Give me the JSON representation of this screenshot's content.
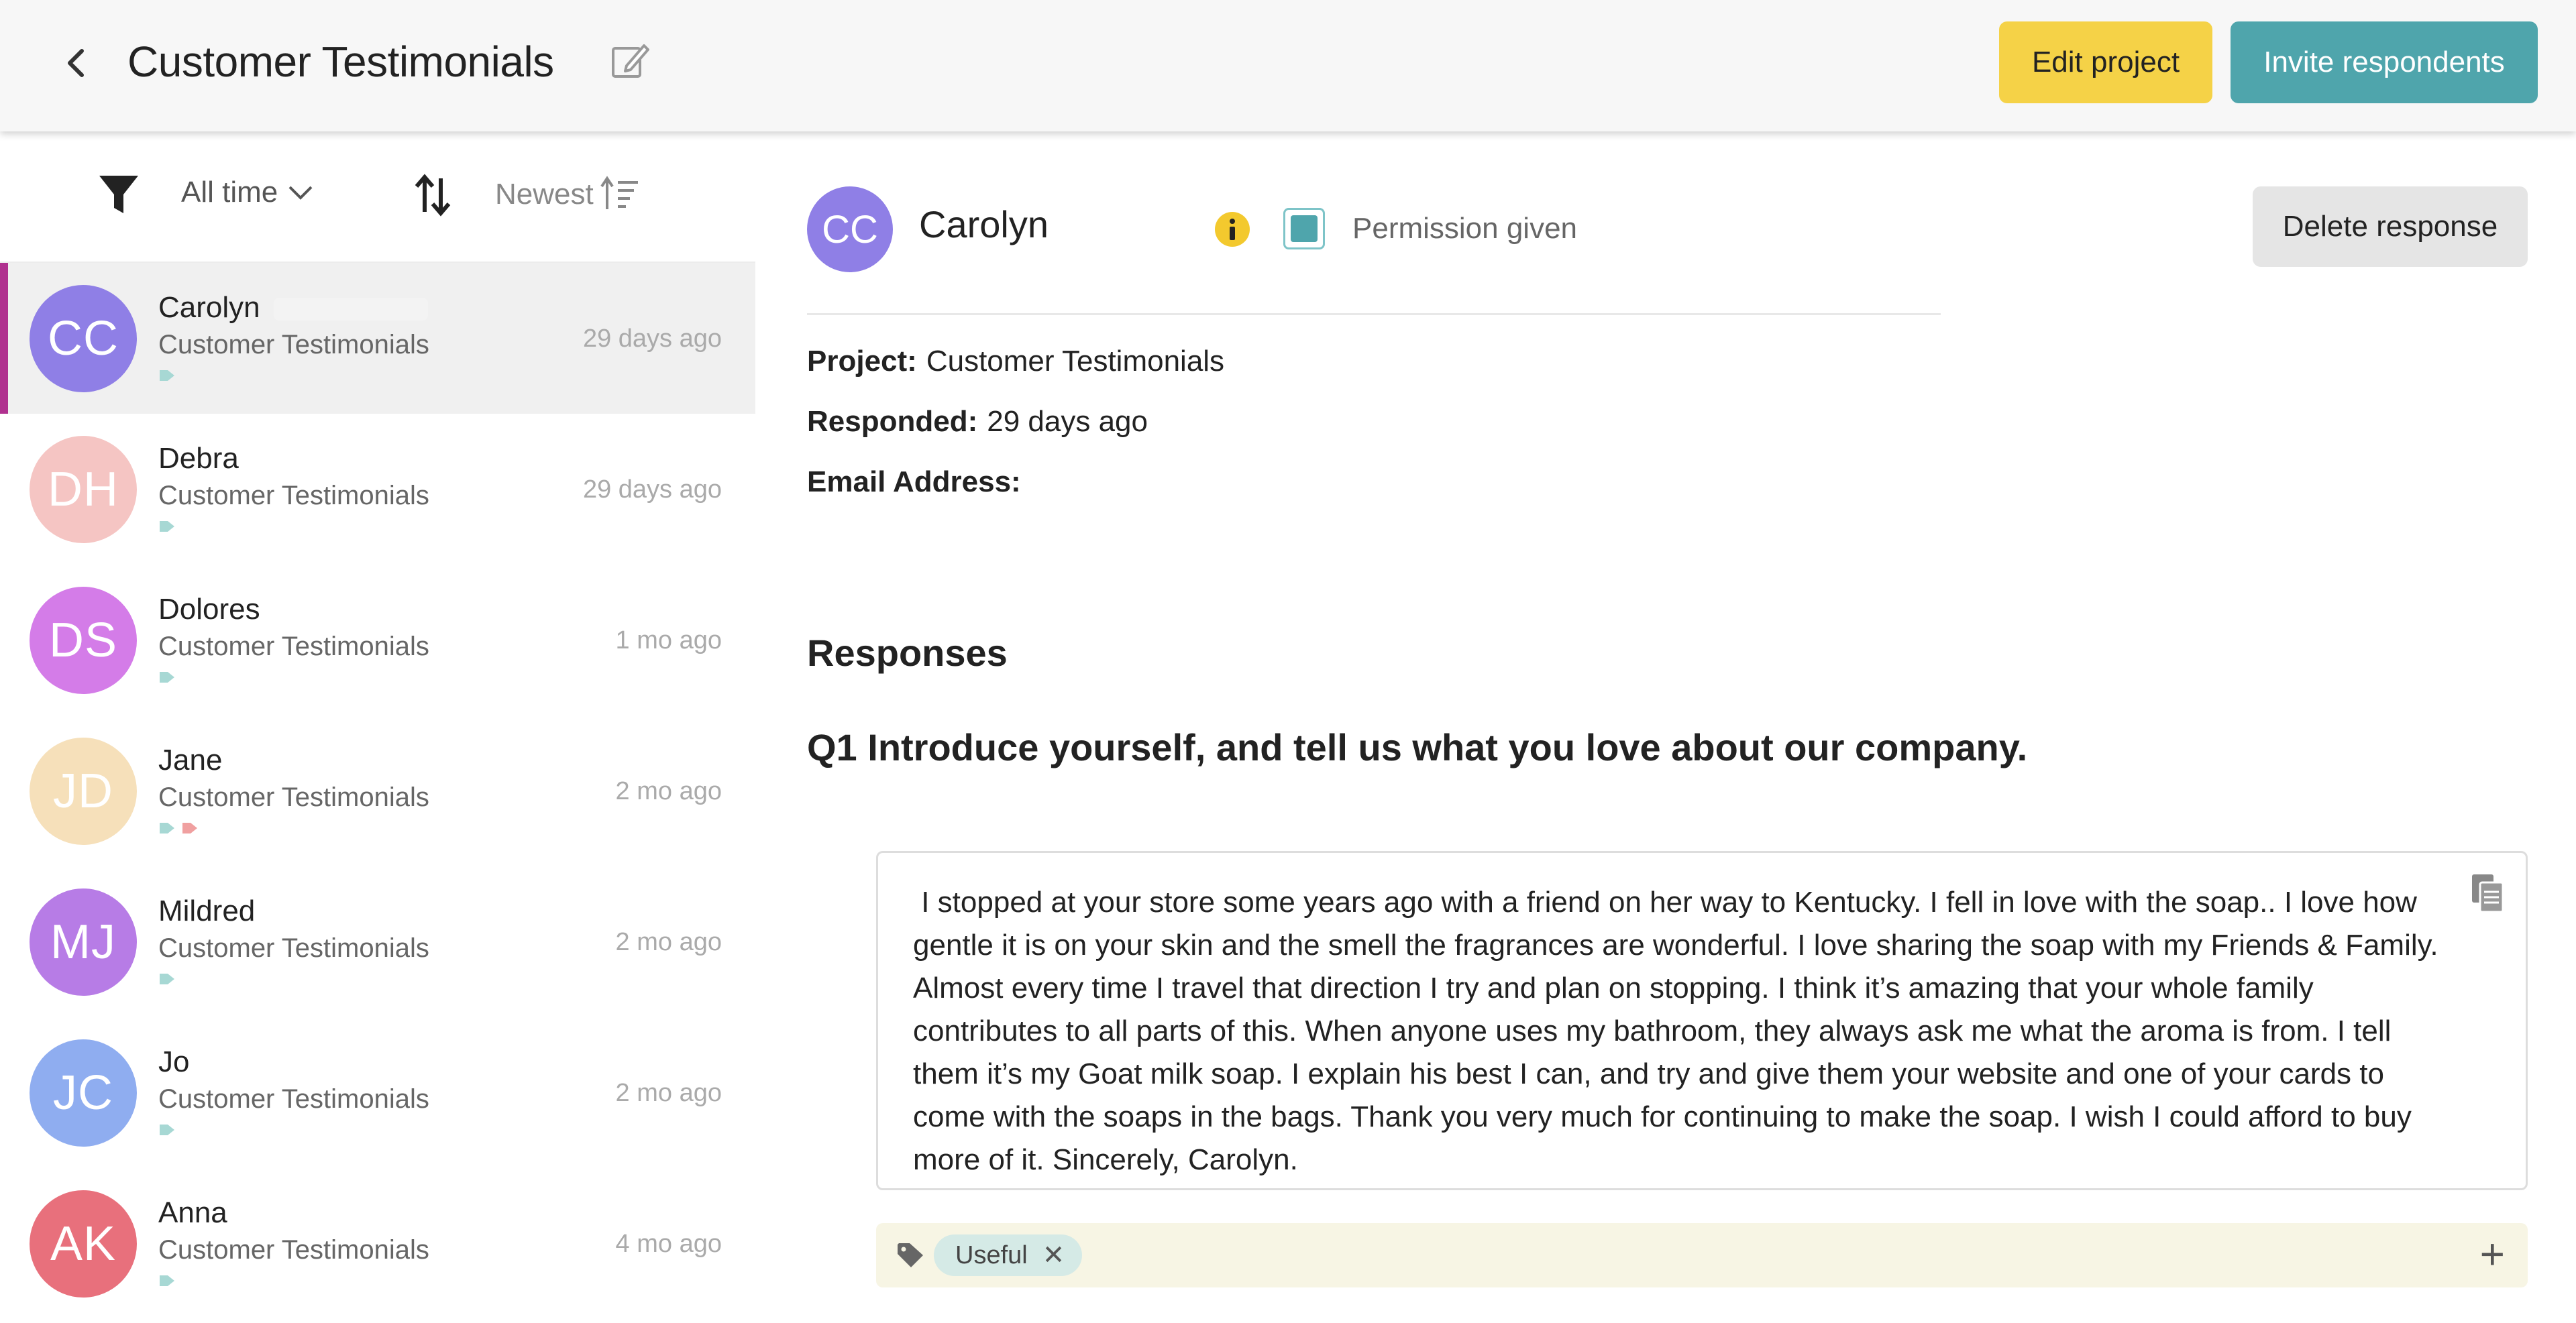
{
  "header": {
    "title": "Customer Testimonials",
    "edit_project_label": "Edit project",
    "invite_label": "Invite respondents"
  },
  "filters": {
    "time_filter": "All time",
    "sort_label": "Newest"
  },
  "responses": [
    {
      "initials": "CC",
      "name": "Carolyn",
      "project": "Customer Testimonials",
      "time": "29 days ago",
      "color": "#8f7fe6",
      "tags": [
        "#a7d8d4"
      ],
      "active": true
    },
    {
      "initials": "DH",
      "name": "Debra",
      "project": "Customer Testimonials",
      "time": "29 days ago",
      "color": "#f5c5c3",
      "tags": [
        "#a7d8d4"
      ]
    },
    {
      "initials": "DS",
      "name": "Dolores",
      "project": "Customer Testimonials",
      "time": "1 mo ago",
      "color": "#d47ce8",
      "tags": [
        "#a7d8d4"
      ]
    },
    {
      "initials": "JD",
      "name": "Jane",
      "project": "Customer Testimonials",
      "time": "2 mo ago",
      "color": "#f6e0ba",
      "tags": [
        "#a7d8d4",
        "#f0a0a0"
      ]
    },
    {
      "initials": "MJ",
      "name": "Mildred",
      "project": "Customer Testimonials",
      "time": "2 mo ago",
      "color": "#b77ce6",
      "tags": [
        "#a7d8d4"
      ]
    },
    {
      "initials": "JC",
      "name": "Jo",
      "project": "Customer Testimonials",
      "time": "2 mo ago",
      "color": "#8fadf0",
      "tags": [
        "#a7d8d4"
      ]
    },
    {
      "initials": "AK",
      "name": "Anna",
      "project": "Customer Testimonials",
      "time": "4 mo ago",
      "color": "#e8707c",
      "tags": [
        "#a7d8d4"
      ]
    }
  ],
  "detail": {
    "initials": "CC",
    "name": "Carolyn",
    "permission_label": "Permission given",
    "delete_label": "Delete response",
    "project_label": "Project:",
    "project_value": "Customer Testimonials",
    "responded_label": "Responded:",
    "responded_value": "29 days ago",
    "email_label": "Email Address:",
    "email_value": "",
    "responses_heading": "Responses",
    "question": "Q1 Introduce yourself, and tell us what you love about our company.",
    "answer": " I stopped at your store some years ago with a friend on her way to Kentucky. I fell in love with the soap.. I love how gentle it is on your skin and the smell the fragrances are wonderful. I love sharing the soap with my Friends & Family. Almost every time I travel that direction I try and plan on stopping. I think it’s amazing that your whole family contributes to all parts of this. When anyone uses my bathroom, they always ask me what the aroma is from. I tell them it’s my Goat milk soap. I explain his best I can, and try and give them your website and one of your cards to come with the soaps in the bags. Thank you very much for continuing to make the soap. I wish I could afford to buy more of it. Sincerely, Carolyn.",
    "tags": [
      "Useful"
    ]
  },
  "colors": {
    "accent_yellow": "#f5d247",
    "accent_teal": "#4fa5ac",
    "active_bar": "#b0318f"
  }
}
